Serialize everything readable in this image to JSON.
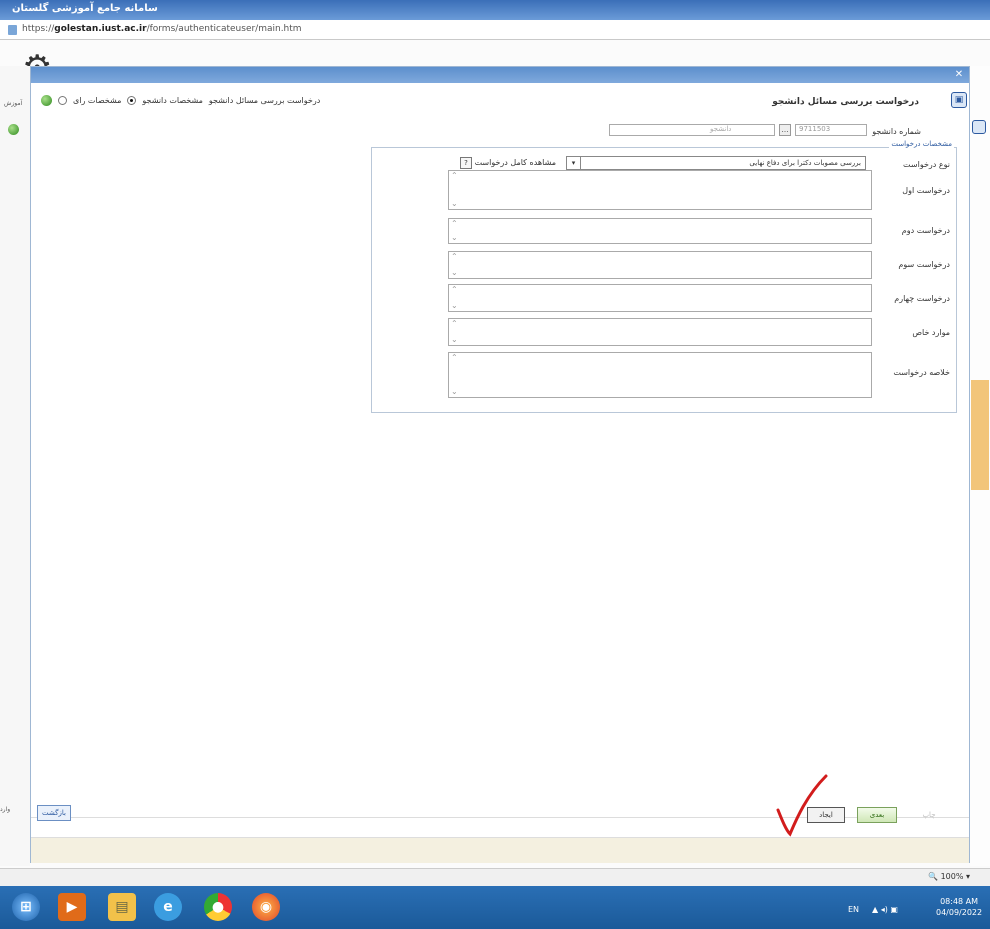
{
  "browser": {
    "title": "سامانه جامع آموزشی گلستان",
    "url_prefix": "https://",
    "url_domain": "golestan.iust.ac.ir",
    "url_path": "/forms/authenticateuser/main.htm",
    "zoom": "100%"
  },
  "dialog": {
    "title": "درخواست بررسی مسائل دانشجو",
    "radio_request": "درخواست بررسی مسائل دانشجو",
    "radio_student": "مشخصات دانشجو",
    "radio_vote": "مشخصات رای",
    "student_no_label": "شماره دانشجو",
    "student_no_value": "9711503",
    "student_name_value": "دانشجو",
    "spec_legend": "مشخصات درخواست",
    "type_label": "نوع درخواست",
    "type_value": "بررسی مصوبات دکترا برای دفاع نهایی",
    "full_view_label": "مشاهده کامل درخواست",
    "requests": [
      {
        "label": "درخواست اول"
      },
      {
        "label": "درخواست دوم"
      },
      {
        "label": "درخواست سوم"
      },
      {
        "label": "درخواست چهارم"
      },
      {
        "label": "موارد خاص"
      },
      {
        "label": "خلاصه درخواست"
      }
    ],
    "buttons": {
      "return": "بازگشت",
      "print": "چاپ",
      "next": "بعدی",
      "save": "ایجاد"
    }
  },
  "side": {
    "left_label": "آموزش",
    "left_bottom": "وارد"
  },
  "taskbar": {
    "lang": "EN",
    "time": "08:48 AM",
    "date": "04/09/2022"
  },
  "colors": {
    "accent": "#2d5aa0",
    "annotation": "#d21c1c"
  }
}
